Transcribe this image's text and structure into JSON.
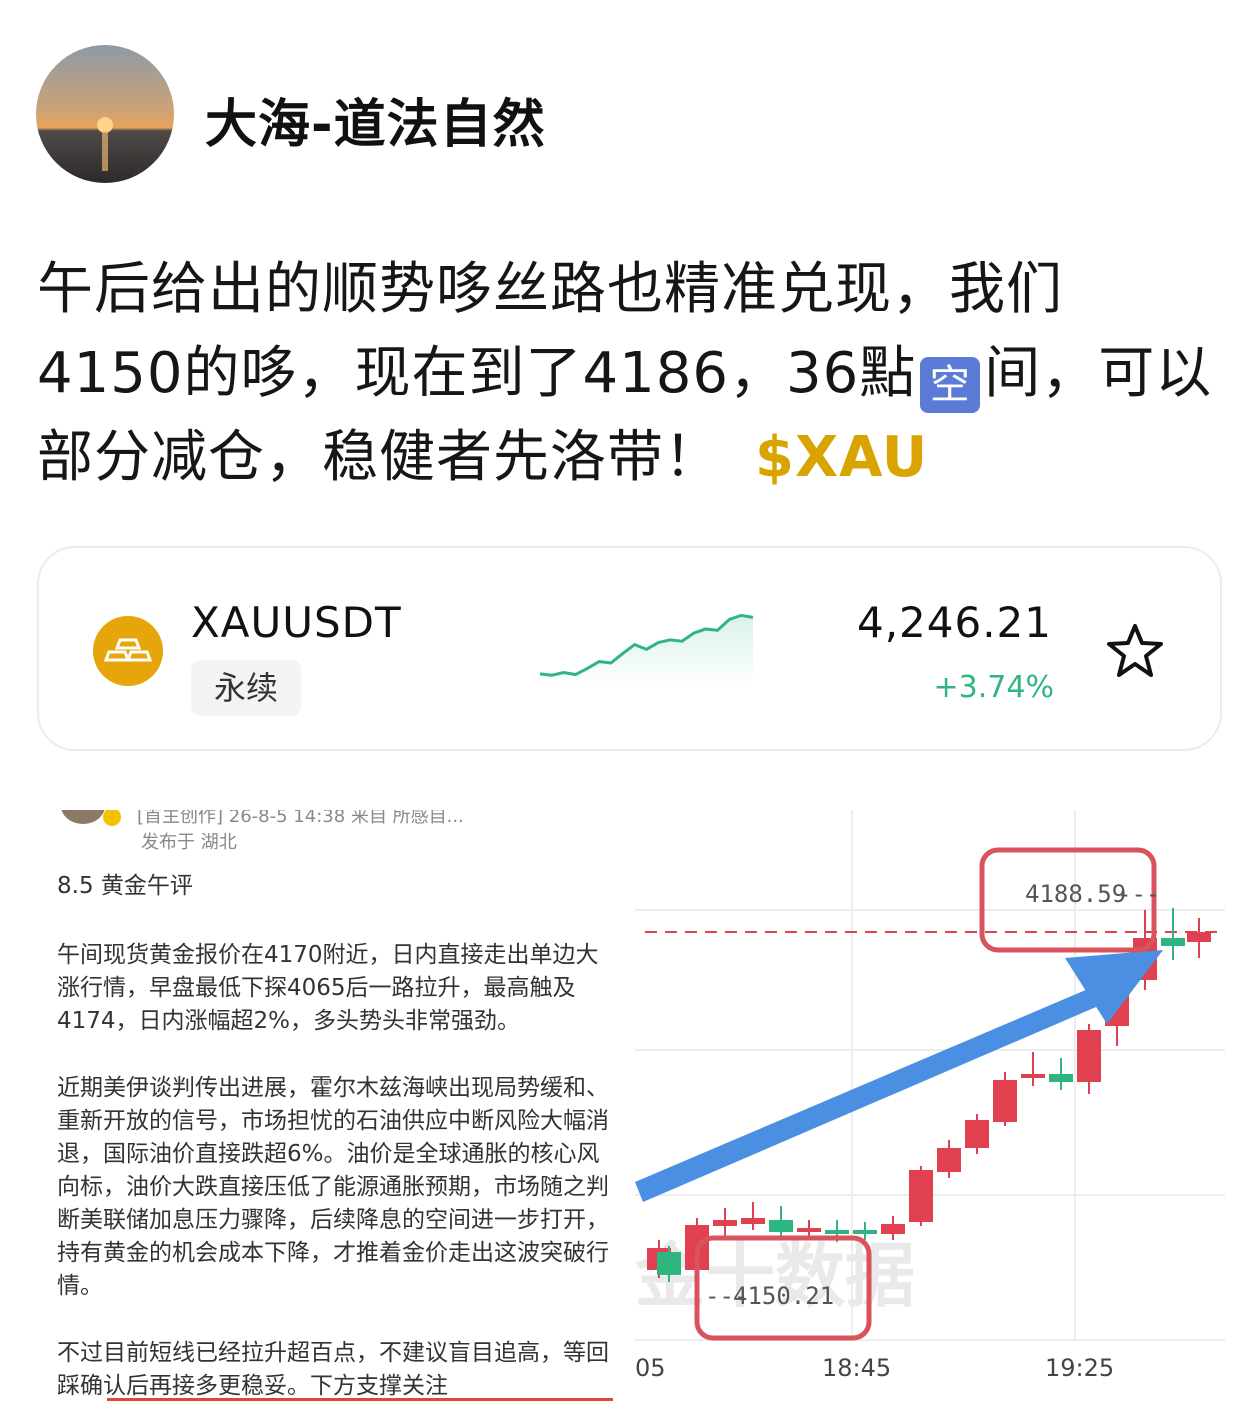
{
  "author": {
    "name": "大海-道法自然"
  },
  "post": {
    "line1": "午后给出的顺势哆丝路也精准兑现，我们",
    "line2_a": "4150的哆，现在到了4186，36點",
    "emoji": "空",
    "line2_b": "间，可以",
    "line3": "部分减仓，稳健者先洛带！",
    "tag": "$XAU"
  },
  "ticker": {
    "symbol": "XAUUSDT",
    "type": "永续",
    "price": "4,246.21",
    "change": "+3.74%",
    "sparkline": [
      0.12,
      0.1,
      0.14,
      0.11,
      0.2,
      0.3,
      0.28,
      0.42,
      0.55,
      0.48,
      0.58,
      0.62,
      0.6,
      0.72,
      0.78,
      0.76,
      0.92,
      0.98,
      0.95
    ],
    "colors": {
      "up": "#2fb57f",
      "accent": "#e5a50b"
    }
  },
  "screenshot_left": {
    "meta_top": "[首主创作] 26-8-5 14:38  来自 所感自...",
    "location": "发布于 湖北",
    "title": "8.5 黄金午评",
    "p1": "午间现货黄金报价在4170附近，日内直接走出单边大涨行情，早盘最低下探4065后一路拉升，最高触及4174，日内涨幅超2%，多头势头非常强劲。",
    "p2": "近期美伊谈判传出进展，霍尔木兹海峡出现局势缓和、重新开放的信号，市场担忧的石油供应中断风险大幅消退，国际油价直接跌超6%。油价是全球通胀的核心风向标，油价大跌直接压低了能源通胀预期，市场随之判断美联储加息压力骤降，后续降息的空间进一步打开，持有黄金的机会成本下降，才推着金价走出这波突破行情。",
    "p3": "不过目前短线已经拉升超百点，不建议盲目追高，等回踩确认后再接多更稳妥。下方支撑关注"
  },
  "screenshot_right": {
    "high_label": "4188.59",
    "low_label": "4150.21",
    "watermark": "金十数据",
    "x_labels": [
      "05",
      "18:45",
      "19:25"
    ],
    "colors": {
      "up": "#e0404f",
      "down": "#2fb57f",
      "arrow": "#4a8fe2",
      "box": "#d9535c"
    }
  }
}
